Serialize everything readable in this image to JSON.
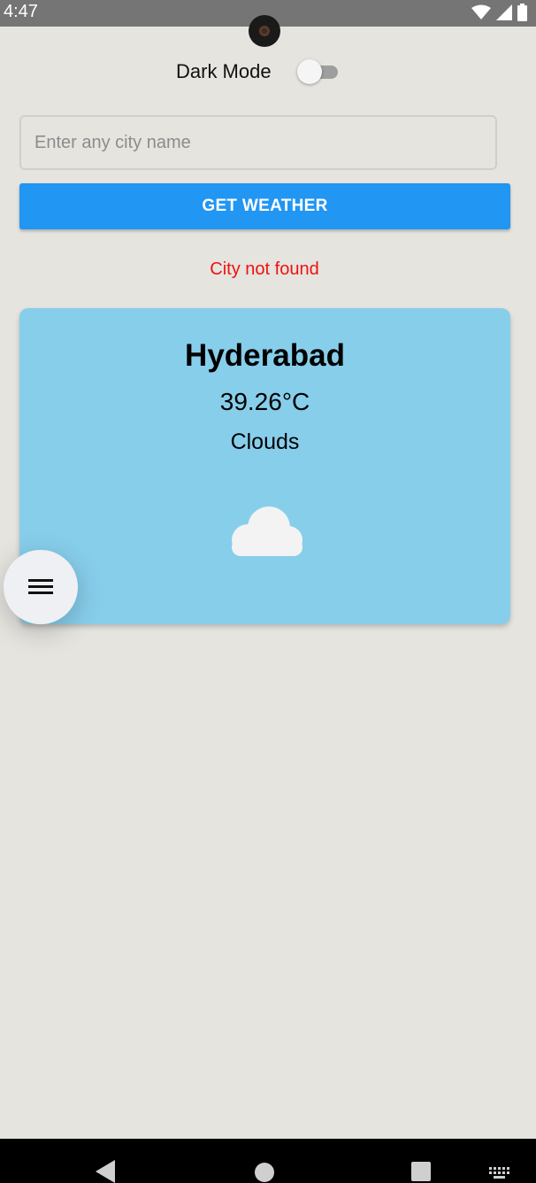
{
  "status_bar": {
    "time": "4:47",
    "icons": [
      "wifi-icon",
      "signal-icon",
      "battery-icon"
    ]
  },
  "settings": {
    "dark_mode_label": "Dark Mode",
    "dark_mode_enabled": false
  },
  "search": {
    "placeholder": "Enter any city name",
    "value": ""
  },
  "actions": {
    "get_weather_label": "GET WEATHER"
  },
  "error": {
    "message": "City not found"
  },
  "weather": {
    "city": "Hyderabad",
    "temperature": "39.26°C",
    "condition": "Clouds",
    "icon": "cloud-icon"
  },
  "fab": {
    "icon": "menu-icon"
  },
  "nav_bar": {
    "icons": [
      "back-icon",
      "home-icon",
      "recents-icon",
      "keyboard-icon"
    ]
  },
  "colors": {
    "background": "#e5e4df",
    "accent": "#2196f3",
    "card": "#87ceeb",
    "error": "#ee1111"
  }
}
